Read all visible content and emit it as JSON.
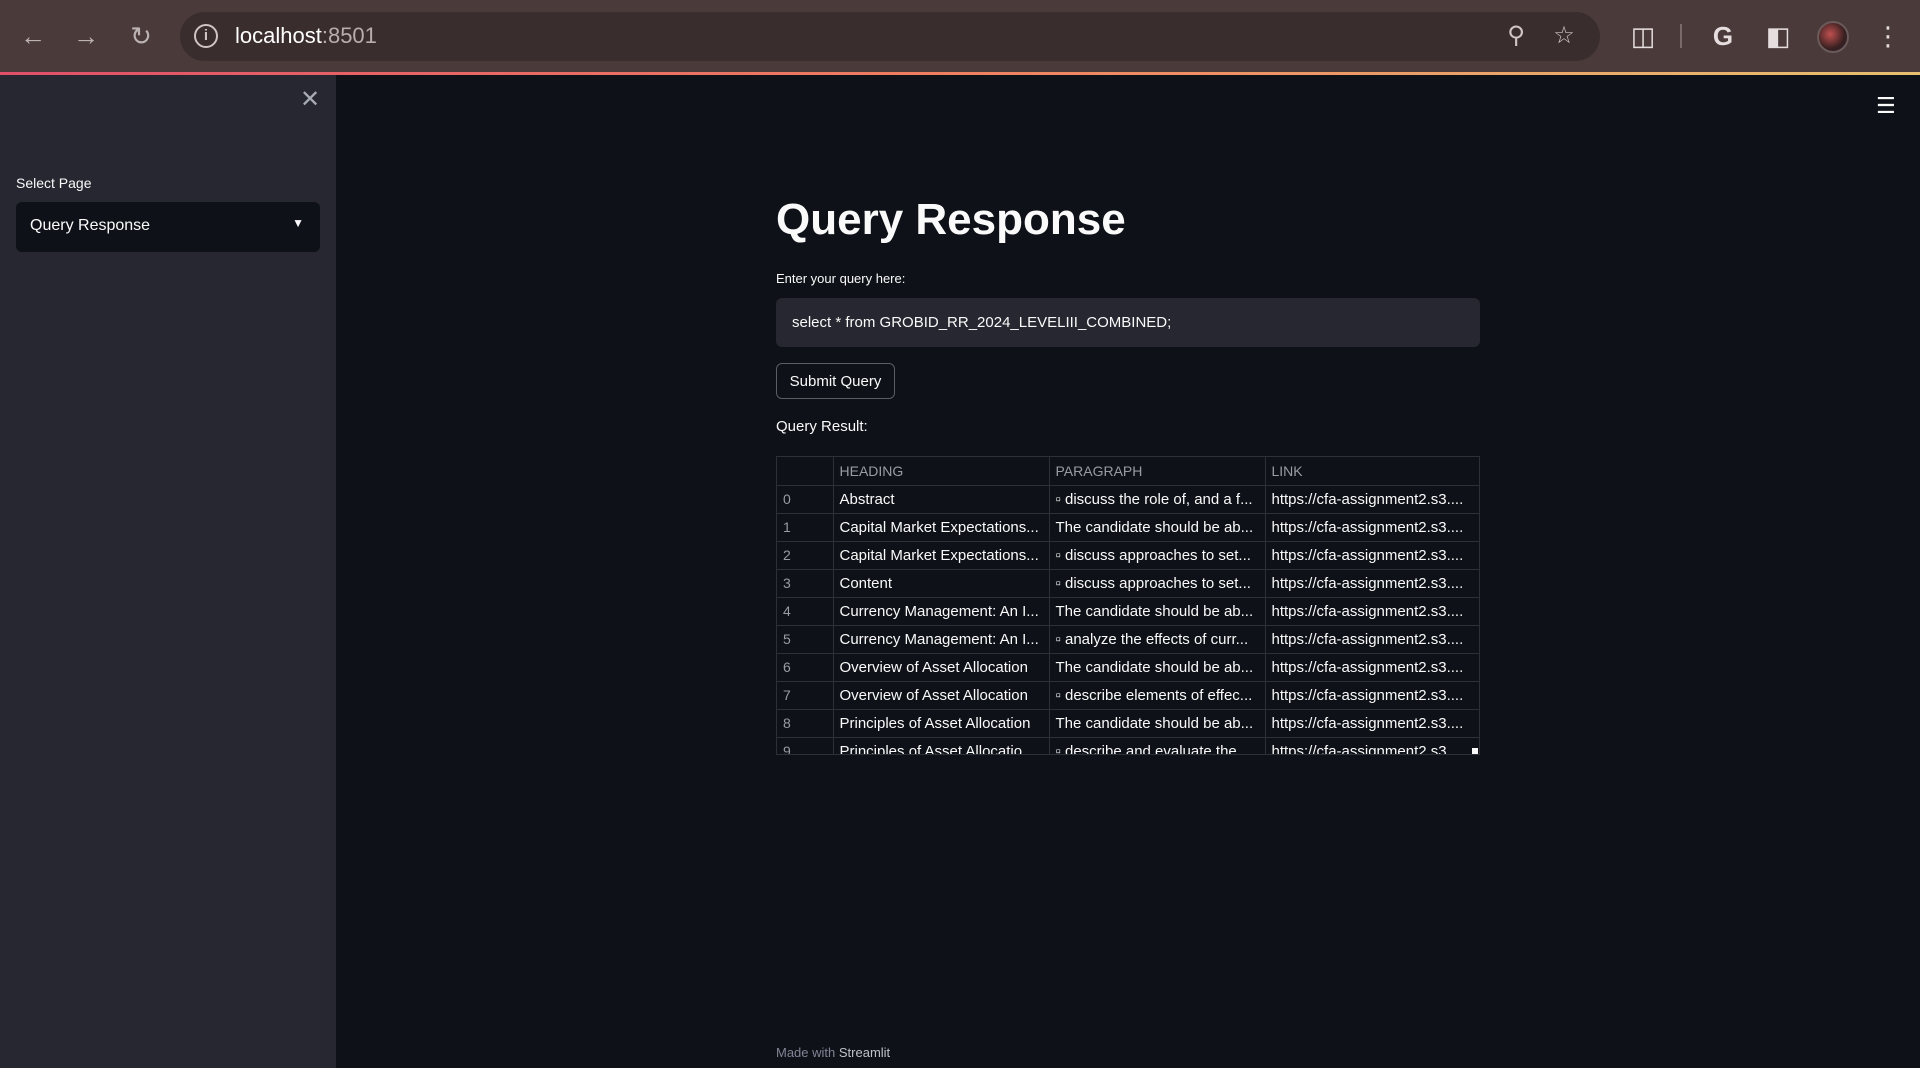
{
  "browser": {
    "url_host": "localhost",
    "url_port": ":8501",
    "icons": {
      "back": "back-arrow-icon",
      "forward": "forward-arrow-icon",
      "reload": "reload-icon",
      "info": "info-icon",
      "zoom": "zoom-icon",
      "bookmark": "star-icon",
      "extensions": "puzzle-icon",
      "google": "google-icon",
      "side_panel": "side-panel-icon",
      "menu": "kebab-menu-icon"
    }
  },
  "sidebar": {
    "select_label": "Select Page",
    "selected_page": "Query Response"
  },
  "main": {
    "title": "Query Response",
    "query_label": "Enter your query here:",
    "query_value": "select * from GROBID_RR_2024_LEVELIII_COMBINED;",
    "submit_label": "Submit Query",
    "result_label": "Query Result:",
    "table": {
      "columns": [
        "",
        "HEADING",
        "PARAGRAPH",
        "LINK"
      ],
      "rows": [
        [
          "0",
          "Abstract",
          "▫ discuss the role of, and a f...",
          "https://cfa-assignment2.s3...."
        ],
        [
          "1",
          "Capital Market Expectations...",
          "The candidate should be ab...",
          "https://cfa-assignment2.s3...."
        ],
        [
          "2",
          "Capital Market Expectations...",
          "▫ discuss approaches to set...",
          "https://cfa-assignment2.s3...."
        ],
        [
          "3",
          "Content",
          "▫ discuss approaches to set...",
          "https://cfa-assignment2.s3...."
        ],
        [
          "4",
          "Currency Management: An I...",
          "The candidate should be ab...",
          "https://cfa-assignment2.s3...."
        ],
        [
          "5",
          "Currency Management: An I...",
          "▫ analyze the effects of curr...",
          "https://cfa-assignment2.s3...."
        ],
        [
          "6",
          "Overview of Asset Allocation",
          "The candidate should be ab...",
          "https://cfa-assignment2.s3...."
        ],
        [
          "7",
          "Overview of Asset Allocation",
          "▫ describe elements of effec...",
          "https://cfa-assignment2.s3...."
        ],
        [
          "8",
          "Principles of Asset Allocation",
          "The candidate should be ab...",
          "https://cfa-assignment2.s3...."
        ],
        [
          "9",
          "Principles of Asset Allocatio...",
          "▫ describe and evaluate the...",
          "https://cfa-assignment2.s3...."
        ]
      ]
    }
  },
  "footer": {
    "prefix": "Made with",
    "brand": "Streamlit"
  },
  "colors": {
    "background": "#0e1117",
    "sidebar": "#262730",
    "text": "#fafafa"
  }
}
